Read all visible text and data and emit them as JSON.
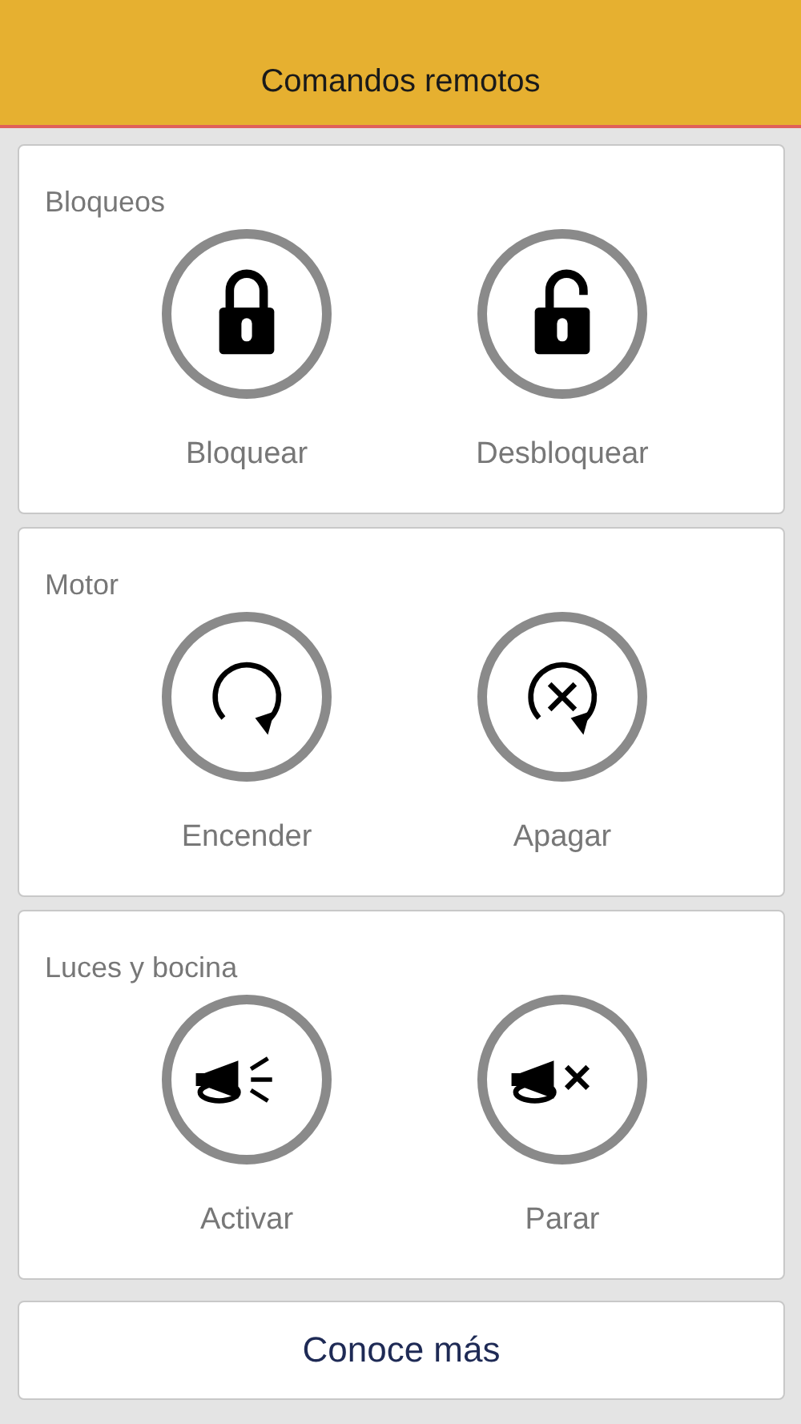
{
  "header": {
    "title": "Comandos remotos"
  },
  "sections": [
    {
      "title": "Bloqueos",
      "buttons": [
        {
          "label": "Bloquear",
          "kind": "lock"
        },
        {
          "label": "Desbloquear",
          "kind": "unlock"
        }
      ]
    },
    {
      "title": "Motor",
      "buttons": [
        {
          "label": "Encender",
          "kind": "start"
        },
        {
          "label": "Apagar",
          "kind": "stop"
        }
      ]
    },
    {
      "title": "Luces y bocina",
      "buttons": [
        {
          "label": "Activar",
          "kind": "horn"
        },
        {
          "label": "Parar",
          "kind": "hornoff"
        }
      ]
    }
  ],
  "footer_button": {
    "label": "Conoce más"
  }
}
